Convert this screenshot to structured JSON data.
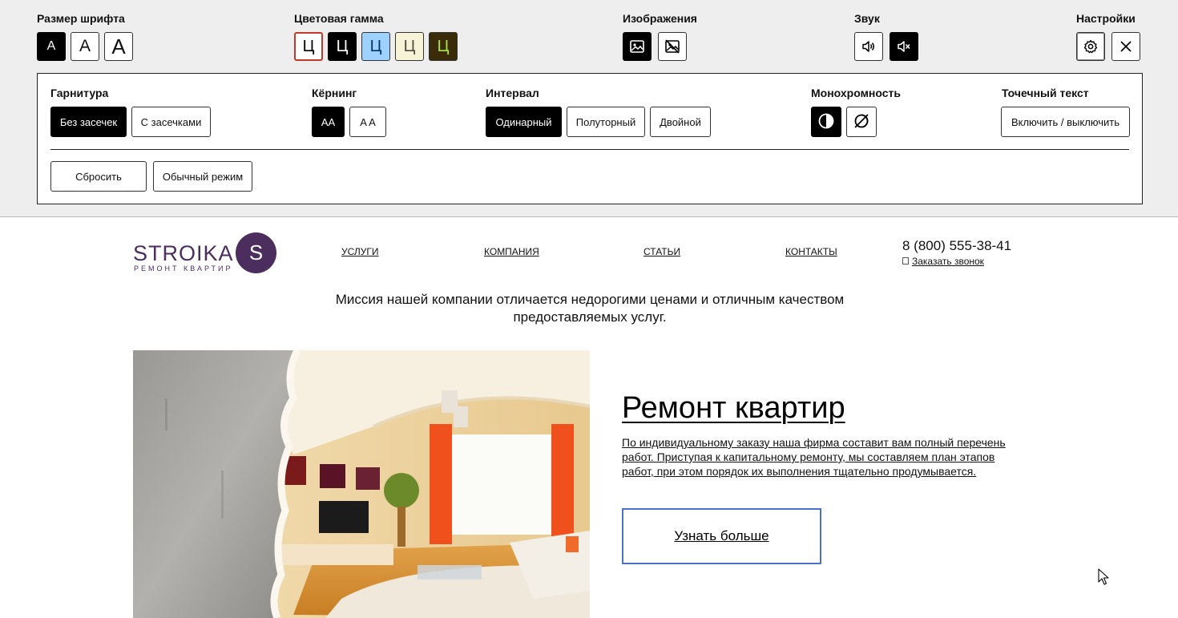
{
  "panel": {
    "font_size": {
      "title": "Размер шрифта",
      "buttons": [
        "A",
        "A",
        "A"
      ]
    },
    "color_scheme": {
      "title": "Цветовая гамма",
      "buttons": [
        "Ц",
        "Ц",
        "Ц",
        "Ц",
        "Ц"
      ]
    },
    "images": {
      "title": "Изображения"
    },
    "sound": {
      "title": "Звук"
    },
    "settings": {
      "title": "Настройки"
    }
  },
  "settings": {
    "typeface": {
      "title": "Гарнитура",
      "options": [
        "Без засечек",
        "С засечками"
      ],
      "selected": "Без засечек"
    },
    "kerning": {
      "title": "Кёрнинг",
      "options": [
        "AA",
        "A A"
      ],
      "selected": "AA"
    },
    "interval": {
      "title": "Интервал",
      "options": [
        "Одинарный",
        "Полуторный",
        "Двойной"
      ],
      "selected": "Одинарный"
    },
    "monochrome": {
      "title": "Монохромность"
    },
    "dotted_text": {
      "title": "Точечный текст",
      "toggle_label": "Включить / выключить"
    },
    "reset_label": "Сбросить",
    "normal_mode_label": "Обычный режим"
  },
  "site": {
    "logo": {
      "name": "STROIKA",
      "subtitle": "РЕМОНТ КВАРТИР",
      "mark": "S"
    },
    "nav": [
      "УСЛУГИ",
      "КОМПАНИЯ",
      "СТАТЬИ",
      "КОНТАКТЫ"
    ],
    "phone": "8 (800) 555-38-41",
    "callback": "Заказать звонок",
    "mission": "Миссия нашей компании отличается недорогими ценами и отличным качеством предоставляемых услуг.",
    "hero": {
      "title": "Ремонт квартир",
      "text": "По индивидуальному заказу наша фирма составит вам полный перечень работ. Приступая к капитальному ремонту, мы составляем план этапов работ, при этом порядок их выполнения тщательно продумывается.",
      "button": "Узнать больше"
    }
  },
  "colors": {
    "brand": "#4b2d5e",
    "scheme": [
      "#ffffff",
      "#000000",
      "#9dd1ff",
      "#f7f3d6",
      "#3b2c09"
    ],
    "scheme_text": [
      "#000000",
      "#ffffff",
      "#063462",
      "#4d4b43",
      "#a9e44d"
    ],
    "button_border": "#4a72c9"
  }
}
